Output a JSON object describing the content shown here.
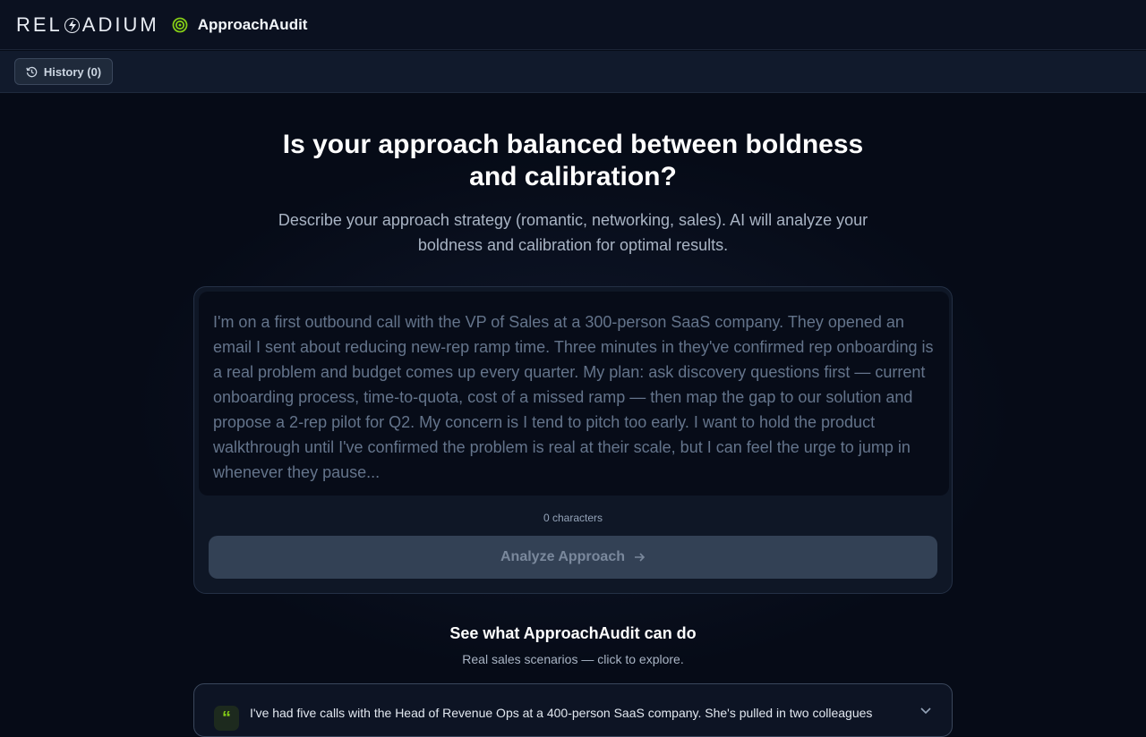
{
  "header": {
    "brand_left": "REL",
    "brand_right": "ADIUM",
    "app_name": "ApproachAudit"
  },
  "toolbar": {
    "history_label": "History (0)"
  },
  "hero": {
    "title_line1": "Is your approach balanced between boldness",
    "title_line2": "and calibration?",
    "subtitle_line1": "Describe your approach strategy (romantic, networking, sales). AI will analyze your",
    "subtitle_line2": "boldness and calibration for optimal results."
  },
  "input": {
    "placeholder": "I'm on a first outbound call with the VP of Sales at a 300-person SaaS company. They opened an email I sent about reducing new-rep ramp time. Three minutes in they've confirmed rep onboarding is a real problem and budget comes up every quarter. My plan: ask discovery questions first — current onboarding process, time-to-quota, cost of a missed ramp — then map the gap to our solution and propose a 2-rep pilot for Q2. My concern is I tend to pitch too early. I want to hold the product walkthrough until I've confirmed the problem is real at their scale, but I can feel the urge to jump in whenever they pause...",
    "value": "",
    "char_count": "0 characters",
    "submit_label": "Analyze Approach"
  },
  "examples": {
    "title": "See what ApproachAudit can do",
    "subtitle": "Real sales scenarios — click to explore.",
    "items": [
      {
        "quote_mark": "“",
        "text": "I've had five calls with the Head of Revenue Ops at a 400-person SaaS company. She's pulled in two colleagues"
      }
    ]
  },
  "colors": {
    "accent_green": "#84cc16",
    "background": "#060b17",
    "button_disabled": "#334155"
  }
}
